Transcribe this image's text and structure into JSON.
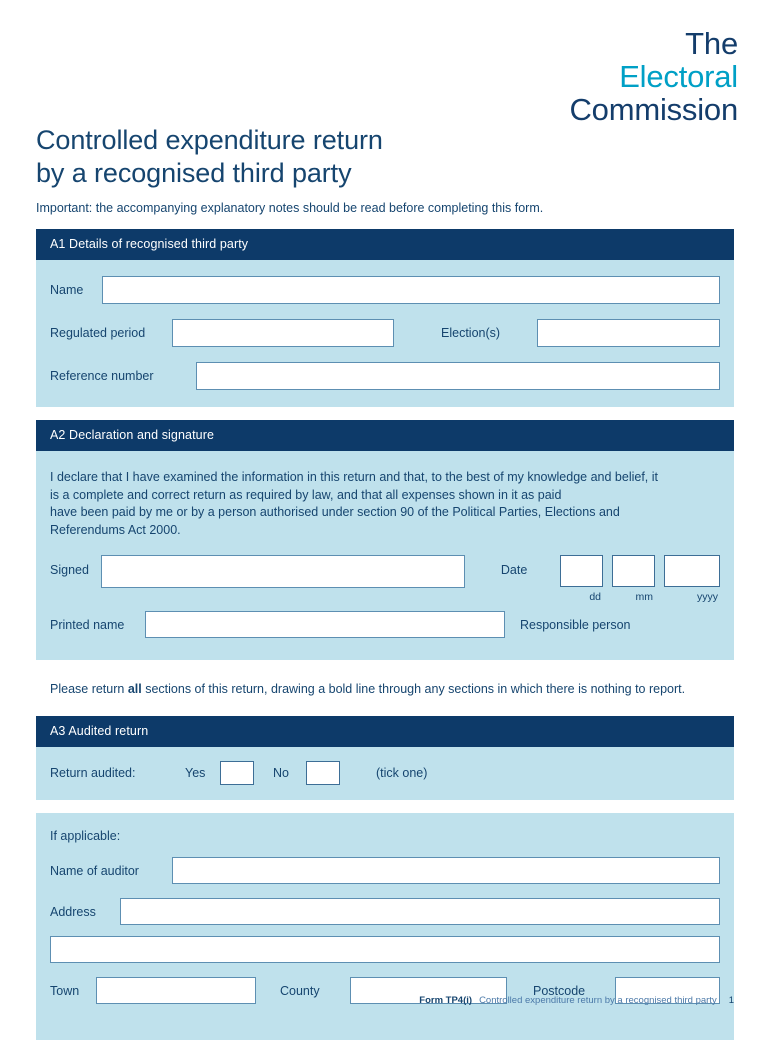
{
  "logo": {
    "line1": "The",
    "line2": "Electoral",
    "line3": "Commission",
    "color_dark": "#143d6b",
    "color_accent": "#00a0c6"
  },
  "page": {
    "title_line1": "Controlled expenditure return",
    "title_line2": "by a recognised third party",
    "subtitle": "Important: the accompanying explanatory notes should be read before completing this form.",
    "header_bar_color": "#0d3a69",
    "section_body_color": "#bfe1ec",
    "field_border_color": "#5d8fb2",
    "text_color": "#16456f"
  },
  "section_a1": {
    "header": "A1 Details of recognised third party",
    "name_label": "Name",
    "name_value": "",
    "regulated_period_label": "Regulated period",
    "regulated_period_value": "",
    "elections_label": "Election(s)",
    "elections_value": "",
    "reference_number_label": "Reference number",
    "reference_number_value": ""
  },
  "section_a2": {
    "header": "A2 Declaration and signature",
    "declaration_line1": "I declare that I have examined the information in this return and that, to the best of my knowledge and belief, it",
    "declaration_line2": "is a complete and correct return as required by law, and that all expenses shown in it as paid",
    "declaration_line3": "have been paid by me or by a person authorised under section 90 of the Political Parties, Elections and",
    "declaration_line4": "Referendums Act 2000.",
    "signed_label": "Signed",
    "signed_value": "",
    "date_label": "Date",
    "date_dd_value": "",
    "date_mm_value": "",
    "date_yyyy_value": "",
    "date_dd_hint": "dd",
    "date_mm_hint": "mm",
    "date_yyyy_hint": "yyyy",
    "printed_name_label": "Printed name",
    "printed_name_value": "",
    "responsible_person_label": "Responsible person"
  },
  "note": {
    "text_before": "Please return ",
    "text_bold": "all",
    "text_after": " sections of this return, drawing a bold line through any sections in which there is nothing to report."
  },
  "section_a3": {
    "header": "A3 Audited return",
    "return_audited_label": "Return audited:",
    "yes_label": "Yes",
    "yes_checked": "",
    "no_label": "No",
    "no_checked": "",
    "tick_one_label": "(tick one)"
  },
  "auditor": {
    "if_applicable_label": "If applicable:",
    "name_of_auditor_label": "Name of auditor",
    "name_of_auditor_value": "",
    "address_label": "Address",
    "address_line1_value": "",
    "address_line2_value": "",
    "town_label": "Town",
    "town_value": "",
    "county_label": "County",
    "county_value": "",
    "postcode_label": "Postcode",
    "postcode_value": ""
  },
  "footer": {
    "form_code": "Form TP4(i)",
    "description": "Controlled expenditure return by a recognised third party",
    "page_number": "1"
  }
}
